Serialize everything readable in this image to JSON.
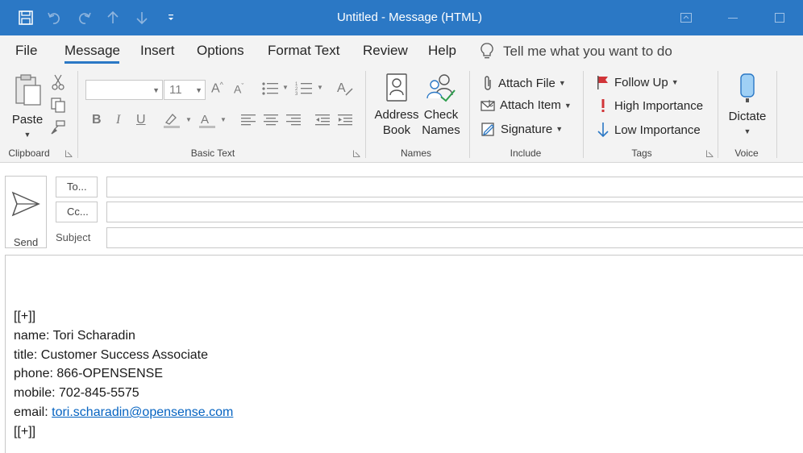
{
  "window": {
    "title": "Untitled  -  Message (HTML)"
  },
  "menu": {
    "tabs": [
      {
        "label": "File"
      },
      {
        "label": "Message"
      },
      {
        "label": "Insert"
      },
      {
        "label": "Options"
      },
      {
        "label": "Format Text"
      },
      {
        "label": "Review"
      },
      {
        "label": "Help"
      }
    ],
    "active_tab": "Message",
    "tell_me": "Tell me what you want to do"
  },
  "ribbon": {
    "clipboard": {
      "paste_label": "Paste",
      "group_label": "Clipboard"
    },
    "basic_text": {
      "font_name": "",
      "font_size": "11",
      "group_label": "Basic Text"
    },
    "names": {
      "address_book_line1": "Address",
      "address_book_line2": "Book",
      "check_names_line1": "Check",
      "check_names_line2": "Names",
      "group_label": "Names"
    },
    "include": {
      "attach_file": "Attach File",
      "attach_item": "Attach Item",
      "signature": "Signature",
      "group_label": "Include"
    },
    "tags": {
      "follow_up": "Follow Up",
      "high_importance": "High Importance",
      "low_importance": "Low Importance",
      "group_label": "Tags"
    },
    "voice": {
      "dictate": "Dictate",
      "group_label": "Voice"
    }
  },
  "compose": {
    "send_label": "Send",
    "to_label": "To...",
    "cc_label": "Cc...",
    "subject_label": "Subject",
    "to_value": "",
    "cc_value": "",
    "subject_value": "",
    "body": {
      "line_open": "[[+]]",
      "name_line": "name: Tori Scharadin",
      "title_line": "title: Customer Success Associate",
      "phone_line": "phone: 866-OPENSENSE",
      "mobile_line": "mobile: 702-845-5575",
      "email_prefix": "email: ",
      "email_link": "tori.scharadin@opensense.com",
      "line_close": "[[+]]"
    }
  },
  "colors": {
    "titlebar": "#2b78c5",
    "ribbon_bg": "#f3f3f3",
    "link": "#0563c1",
    "flag_red": "#d13438",
    "low_importance_blue": "#2b78c5"
  }
}
